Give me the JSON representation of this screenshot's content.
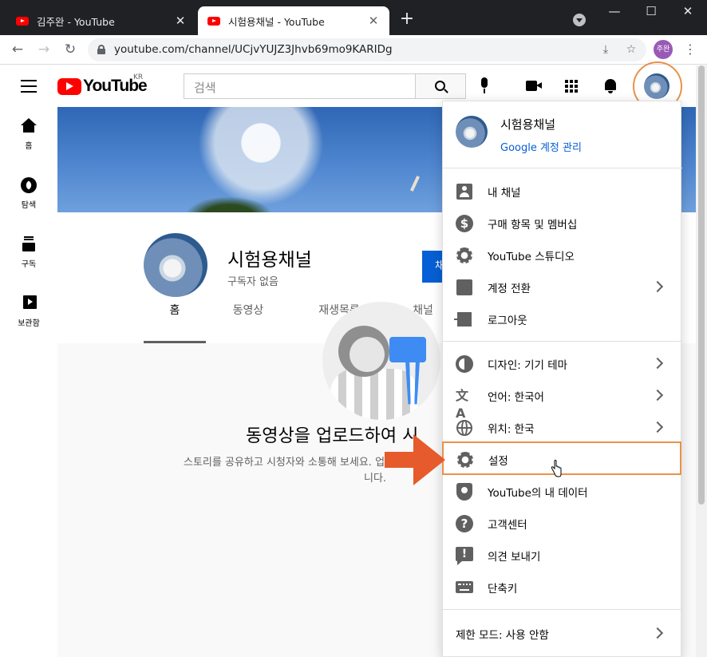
{
  "browser": {
    "tabs": [
      {
        "label": "김주완 - YouTube",
        "active": false
      },
      {
        "label": "시험용채널 - YouTube",
        "active": true
      }
    ],
    "new_tab": "+",
    "url": "youtube.com/channel/UCjvYUJZ3Jhvb69mo9KARIDg",
    "profile_initials": "주완",
    "window_controls": [
      "minimize",
      "maximize",
      "close"
    ]
  },
  "header": {
    "logo_word": "YouTube",
    "country": "KR",
    "search_placeholder": "검색"
  },
  "guide": {
    "items": [
      {
        "label": "홈",
        "icon": "home-icon"
      },
      {
        "label": "탐색",
        "icon": "explore-icon"
      },
      {
        "label": "구독",
        "icon": "subscriptions-icon"
      },
      {
        "label": "보관함",
        "icon": "library-icon"
      }
    ]
  },
  "channel": {
    "name": "시험용채널",
    "subscribers": "구독자 없음",
    "customize_button_partial": "채",
    "tabs": [
      "홈",
      "동영상",
      "재생목록",
      "채널"
    ],
    "active_tab": "홈",
    "empty_title": "동영상을 업로드하여 시",
    "empty_subtitle": "스토리를 공유하고 시청자와 소통해 보세요. 업로드한",
    "empty_subtitle_line2": "니다."
  },
  "account_menu": {
    "name": "시험용채널",
    "manage_link": "Google 계정 관리",
    "section1": [
      {
        "label": "내 채널",
        "icon": "person-icon",
        "has_submenu": false
      },
      {
        "label": "구매 항목 및 멤버십",
        "icon": "dollar-icon",
        "has_submenu": false
      },
      {
        "label": "YouTube 스튜디오",
        "icon": "gear-icon",
        "has_submenu": false
      },
      {
        "label": "계정 전환",
        "icon": "switch-account-icon",
        "has_submenu": true
      },
      {
        "label": "로그아웃",
        "icon": "logout-icon",
        "has_submenu": false
      }
    ],
    "section2": [
      {
        "label": "디자인: 기기 테마",
        "icon": "theme-icon",
        "has_submenu": true
      },
      {
        "label": "언어: 한국어",
        "icon": "language-icon",
        "has_submenu": true
      },
      {
        "label": "위치: 한국",
        "icon": "globe-icon",
        "has_submenu": true
      },
      {
        "label": "설정",
        "icon": "gear-icon",
        "has_submenu": false,
        "highlighted": true
      },
      {
        "label": "YouTube의 내 데이터",
        "icon": "shield-icon",
        "has_submenu": false
      },
      {
        "label": "고객센터",
        "icon": "help-icon",
        "has_submenu": false
      },
      {
        "label": "의견 보내기",
        "icon": "feedback-icon",
        "has_submenu": false
      },
      {
        "label": "단축키",
        "icon": "keyboard-icon",
        "has_submenu": false
      }
    ],
    "section3": [
      {
        "label": "제한 모드: 사용 안함",
        "has_submenu": true
      }
    ]
  },
  "colors": {
    "highlight": "#e8924a",
    "arrow": "#e65a2b",
    "youtube_red": "#ff0000",
    "link_blue": "#065fd4"
  }
}
